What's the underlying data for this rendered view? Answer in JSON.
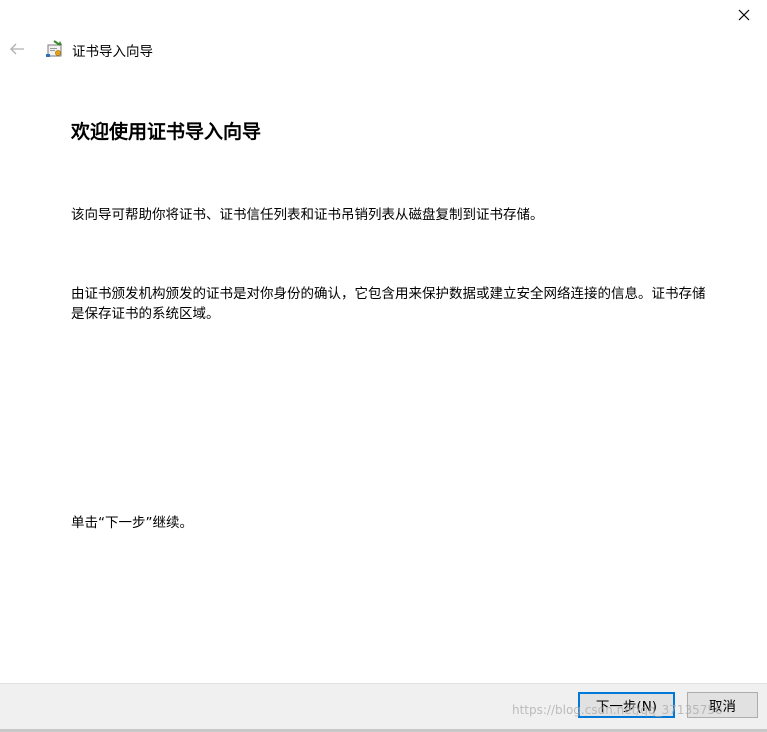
{
  "window": {
    "close_glyph": "✕"
  },
  "header": {
    "back_glyph": "←",
    "icon": "certificate-wizard-icon",
    "title": "证书导入向导"
  },
  "main": {
    "heading": "欢迎使用证书导入向导",
    "paragraph1": "该向导可帮助你将证书、证书信任列表和证书吊销列表从磁盘复制到证书存储。",
    "paragraph2": "由证书颁发机构颁发的证书是对你身份的确认，它包含用来保护数据或建立安全网络连接的信息。证书存储是保存证书的系统区域。",
    "paragraph3": "单击“下一步”继续。"
  },
  "footer": {
    "next_label": "下一步(N)",
    "cancel_label": "取消"
  },
  "watermark": {
    "text": "https://blog.csdn.net/qq_37135756"
  },
  "colors": {
    "accent": "#0078d7",
    "footer_bg": "#f0f0f0",
    "button_bg": "#e1e1e1"
  }
}
